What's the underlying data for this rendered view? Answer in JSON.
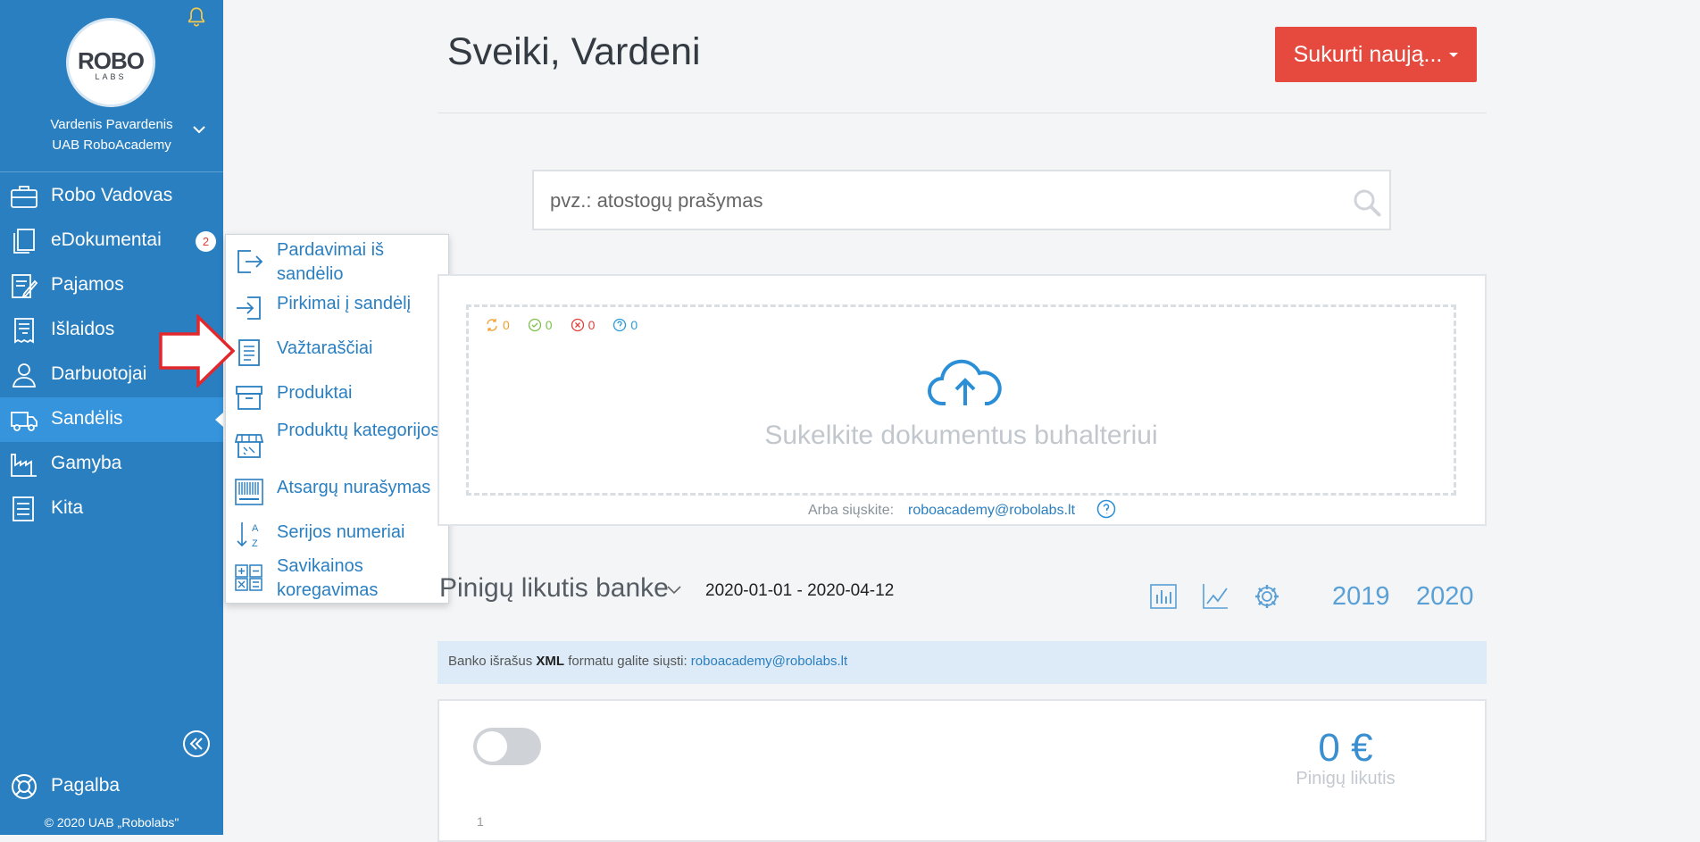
{
  "sidebar": {
    "user_name": "Vardenis Pavardenis",
    "company": "UAB RoboAcademy",
    "logo_top": "ROBO",
    "logo_bottom": "LABS",
    "nav": [
      {
        "label": "Robo Vadovas",
        "icon": "briefcase-icon"
      },
      {
        "label": "eDokumentai",
        "icon": "documents-icon",
        "badge": "2"
      },
      {
        "label": "Pajamos",
        "icon": "income-icon"
      },
      {
        "label": "Išlaidos",
        "icon": "receipt-icon"
      },
      {
        "label": "Darbuotojai",
        "icon": "employee-icon"
      },
      {
        "label": "Sandėlis",
        "icon": "truck-icon",
        "active": true
      },
      {
        "label": "Gamyba",
        "icon": "factory-icon"
      },
      {
        "label": "Kita",
        "icon": "list-icon"
      }
    ],
    "help_label": "Pagalba",
    "copyright": "© 2020 UAB „Robolabs\""
  },
  "dropdown": {
    "items": [
      {
        "label": "Pardavimai iš sandėlio",
        "icon": "exit-icon"
      },
      {
        "label": "Pirkimai į sandėlį",
        "icon": "enter-icon"
      },
      {
        "label": "Važtaraščiai",
        "icon": "document-icon"
      },
      {
        "label": "Produktai",
        "icon": "box-icon"
      },
      {
        "label": "Produktų kategorijos",
        "icon": "store-icon"
      },
      {
        "label": "Atsargų nurašymas",
        "icon": "barcode-icon"
      },
      {
        "label": "Serijos numeriai",
        "icon": "sort-az-icon"
      },
      {
        "label": "Savikainos koregavimas",
        "icon": "calculator-icon"
      }
    ]
  },
  "header": {
    "greeting": "Sveiki, Vardeni",
    "create_button": "Sukurti naują..."
  },
  "search": {
    "placeholder": "pvz.: atostogų prašymas"
  },
  "upload": {
    "counters": [
      {
        "value": "0",
        "color": "#f0a030",
        "icon": "sync-icon"
      },
      {
        "value": "0",
        "color": "#7cc04a",
        "icon": "check-circle-icon"
      },
      {
        "value": "0",
        "color": "#e0403a",
        "icon": "x-circle-icon"
      },
      {
        "value": "0",
        "color": "#2a9ad8",
        "icon": "question-circle-icon"
      }
    ],
    "drop_text": "Sukelkite dokumentus buhalteriui",
    "send_label": "Arba siųskite:",
    "email": "roboacademy@robolabs.lt"
  },
  "bank": {
    "title": "Pinigų likutis banke",
    "date_range": "2020-01-01 - 2020-04-12",
    "years": [
      "2019",
      "2020"
    ],
    "info_prefix": "Banko išrašus ",
    "info_bold": "XML",
    "info_suffix": " formatu galite siųsti: ",
    "info_email": "roboacademy@robolabs.lt",
    "balance_value": "0 €",
    "balance_label": "Pinigų likutis",
    "axis_tick": "1"
  },
  "colors": {
    "sidebar": "#2a7fc1",
    "active": "#3694dc",
    "accent_red": "#e64a3e"
  }
}
